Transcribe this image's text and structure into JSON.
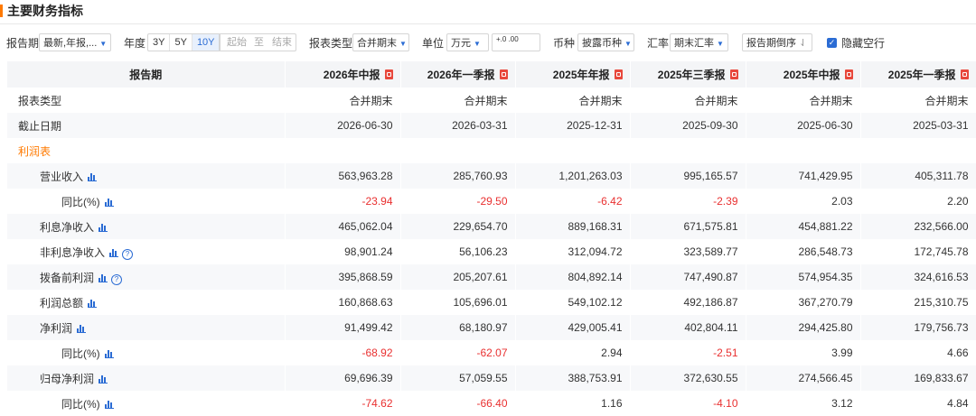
{
  "title": "主要财务指标",
  "toolbar": {
    "report_period_label": "报告期",
    "report_period_value": "最新,年报,...",
    "year_label": "年度",
    "year_options": [
      "3Y",
      "5Y",
      "10Y"
    ],
    "year_selected": "10Y",
    "range_start": "起始",
    "range_to": "至",
    "range_end": "结束",
    "report_type_label": "报表类型",
    "report_type_value": "合并期末",
    "unit_label": "单位",
    "unit_value": "万元",
    "decimal_add": "+.0",
    "decimal_add2": ".00",
    "currency_label": "币种",
    "currency_value": "披露币种",
    "exchange_label": "汇率",
    "exchange_value": "期末汇率",
    "sort_button": "报告期倒序",
    "hide_empty_label": "隐藏空行"
  },
  "table": {
    "header_first": "报告期",
    "columns": [
      "2026年中报",
      "2026年一季报",
      "2025年年报",
      "2025年三季报",
      "2025年中报",
      "2025年一季报"
    ],
    "rows": [
      {
        "label": "报表类型",
        "cells": [
          "合并期末",
          "合并期末",
          "合并期末",
          "合并期末",
          "合并期末",
          "合并期末"
        ]
      },
      {
        "label": "截止日期",
        "cells": [
          "2026-06-30",
          "2026-03-31",
          "2025-12-31",
          "2025-09-30",
          "2025-06-30",
          "2025-03-31"
        ]
      },
      {
        "label": "利润表",
        "cells": [
          "",
          "",
          "",
          "",
          "",
          ""
        ]
      },
      {
        "label": "营业收入",
        "cells": [
          "563,963.28",
          "285,760.93",
          "1,201,263.03",
          "995,165.57",
          "741,429.95",
          "405,311.78"
        ]
      },
      {
        "label": "同比(%)",
        "cells": [
          "-23.94",
          "-29.50",
          "-6.42",
          "-2.39",
          "2.03",
          "2.20"
        ]
      },
      {
        "label": "利息净收入",
        "cells": [
          "465,062.04",
          "229,654.70",
          "889,168.31",
          "671,575.81",
          "454,881.22",
          "232,566.00"
        ]
      },
      {
        "label": "非利息净收入",
        "cells": [
          "98,901.24",
          "56,106.23",
          "312,094.72",
          "323,589.77",
          "286,548.73",
          "172,745.78"
        ]
      },
      {
        "label": "拨备前利润",
        "cells": [
          "395,868.59",
          "205,207.61",
          "804,892.14",
          "747,490.87",
          "574,954.35",
          "324,616.53"
        ]
      },
      {
        "label": "利润总额",
        "cells": [
          "160,868.63",
          "105,696.01",
          "549,102.12",
          "492,186.87",
          "367,270.79",
          "215,310.75"
        ]
      },
      {
        "label": "净利润",
        "cells": [
          "91,499.42",
          "68,180.97",
          "429,005.41",
          "402,804.11",
          "294,425.80",
          "179,756.73"
        ]
      },
      {
        "label": "同比(%)",
        "cells": [
          "-68.92",
          "-62.07",
          "2.94",
          "-2.51",
          "3.99",
          "4.66"
        ]
      },
      {
        "label": "归母净利润",
        "cells": [
          "69,696.39",
          "57,059.55",
          "388,753.91",
          "372,630.55",
          "274,566.45",
          "169,833.67"
        ]
      },
      {
        "label": "同比(%)",
        "cells": [
          "-74.62",
          "-66.40",
          "1.16",
          "-4.10",
          "3.12",
          "4.84"
        ]
      }
    ]
  },
  "colors": {
    "accent": "#2b6cd4",
    "section": "#ff7a00",
    "negative": "#e93030",
    "pdf": "#e8483c"
  }
}
